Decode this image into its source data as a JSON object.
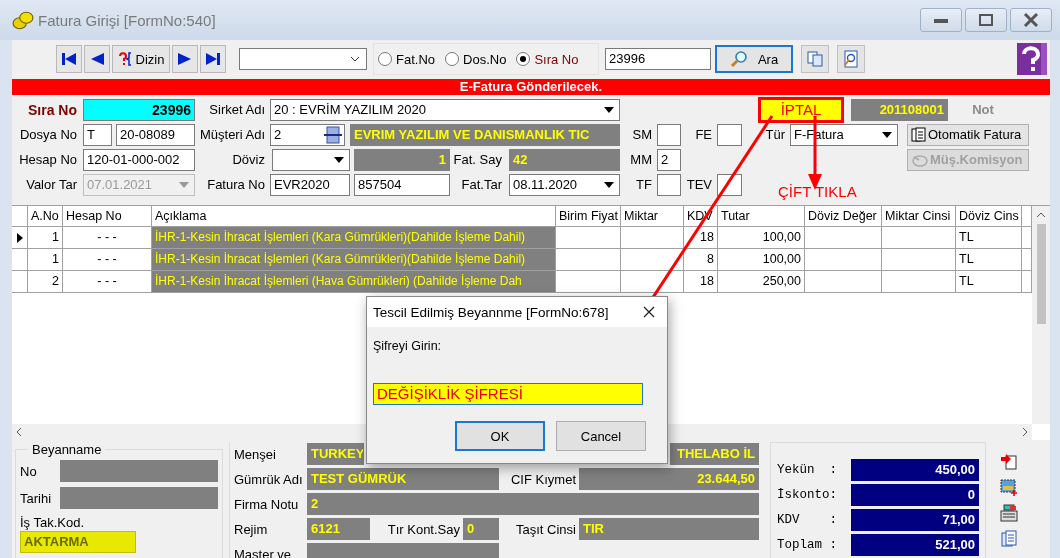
{
  "window": {
    "title": "Fatura Girişi [FormNo:540]"
  },
  "toolbar": {
    "index_button": "Dizin",
    "search_by": [
      {
        "label": "Fat.No",
        "selected": false
      },
      {
        "label": "Dos.No",
        "selected": false
      },
      {
        "label": "Sıra No",
        "selected": true
      }
    ],
    "search_value": "23996",
    "search_button": "Ara"
  },
  "banner": "E-Fatura Gönderilecek.",
  "header": {
    "sira_no_label": "Sıra No",
    "sira_no": "23996",
    "sirket_label": "Sirket Adı",
    "sirket": "20 : EVRİM YAZILIM  2020",
    "status": "İPTAL",
    "code": "201108001",
    "not_label": "Not",
    "dosya_label": "Dosya No",
    "dosya_prefix": "T",
    "dosya_no": "20-08089",
    "musteri_label": "Müşteri Adı",
    "musteri_code": "2",
    "musteri_name": "EVRIM YAZILIM VE DANISMANLIK TIC",
    "sm_label": "SM",
    "fe_label": "FE",
    "tur_label": "Tür",
    "tur": "F-Fatura",
    "auto_button": "Otomatik Fatura",
    "hesap_label": "Hesap No",
    "hesap_no": "120-01-000-002",
    "doviz_label": "Döviz",
    "kur": "1",
    "fat_say_label": "Fat. Say",
    "fat_say": "42",
    "mm_label": "MM",
    "mm": "2",
    "komisyon_button": {
      "label": "Müş.Komisyon",
      "disabled": true
    },
    "valor_label": "Valor Tar",
    "valor": {
      "value": "07.01.2021",
      "disabled": true
    },
    "fatura_no_label": "Fatura No",
    "fatura_seri": "EVR2020",
    "fatura_no": "857504",
    "fat_tar_label": "Fat.Tar",
    "fat_tar": "08.11.2020",
    "tf_label": "TF",
    "tev_label": "TEV"
  },
  "annotation": "ÇİFT TIKLA",
  "table": {
    "columns": [
      "A.No",
      "Hesap No",
      "Açıklama",
      "Birim Fiyat",
      "Miktar",
      "KDV",
      "Tutar",
      "Döviz Değer",
      "Miktar Cinsi",
      "Döviz Cins"
    ],
    "rows": [
      {
        "current": true,
        "cells": [
          "1",
          "- - -",
          "İHR-1-Kesin İhracat İşlemleri (Kara Gümrükleri)(Dahilde İşleme Dahil)",
          "",
          "",
          "18",
          "100,00",
          "",
          "",
          "TL"
        ]
      },
      {
        "current": false,
        "cells": [
          "1",
          "- - -",
          "İHR-1-Kesin İhracat İşlemleri (Kara Gümrükleri)(Dahilde İşleme Dahil)",
          "",
          "",
          "8",
          "100,00",
          "",
          "",
          "TL"
        ]
      },
      {
        "current": false,
        "cells": [
          "2",
          "- - -",
          "İHR-1-Kesin İhracat İşlemleri (Hava Gümrükleri) (Dahilde İşleme Dah",
          "",
          "",
          "18",
          "250,00",
          "",
          "",
          "TL"
        ]
      }
    ]
  },
  "beyanname": {
    "title": "Beyanname",
    "no_label": "No",
    "tarih_label": "Tarihi",
    "is_takip_label": "İş Tak.Kod.",
    "is_takip": "AKTARMA"
  },
  "details": {
    "mensei_label": "Menşei",
    "mensei": "TURKEY",
    "field_right": "THELABO İL",
    "gumruk_label": "Gümrük Adı",
    "gumruk": "TEST GÜMRÜK",
    "cif_label": "CIF Kıymet",
    "cif": "23.644,50",
    "firma_label": "Firma Notu",
    "firma": "2",
    "rejim_label": "Rejim",
    "rejim": "6121",
    "tir_label": "Tır Kont.Say",
    "tir": "0",
    "tasit_label": "Taşıt Cinsi",
    "tasit": "TIR",
    "master_label": "Master ve"
  },
  "totals": [
    {
      "label": "Yekün  :",
      "value": "450,00"
    },
    {
      "label": "İskonto:",
      "value": "0"
    },
    {
      "label": "KDV    :",
      "value": "71,00"
    },
    {
      "label": "Toplam :",
      "value": "521,00"
    }
  ],
  "dialog": {
    "title": "Tescil Edilmiş Beyannme [FormNo:678]",
    "prompt": "Şifreyi Girin:",
    "password": "DEĞİŞİKLİK ŞİFRESİ",
    "ok": "OK",
    "cancel": "Cancel"
  }
}
